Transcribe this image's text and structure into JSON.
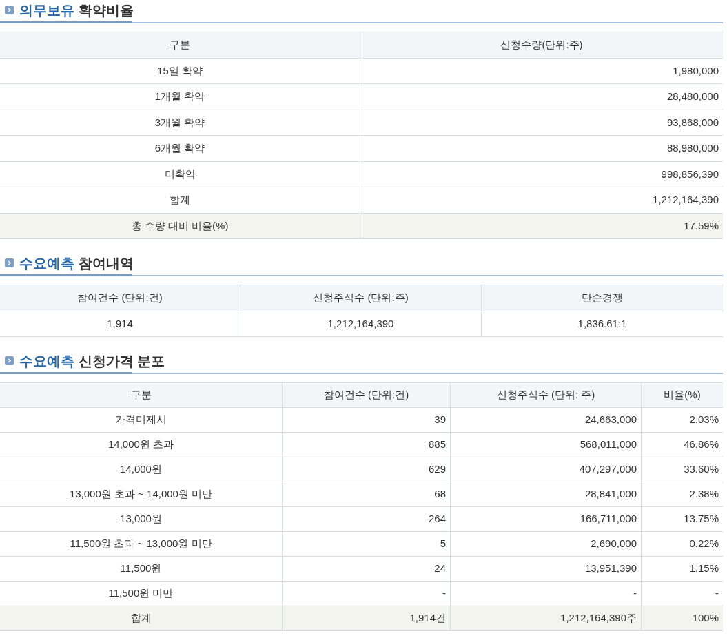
{
  "sections": [
    {
      "title": {
        "highlight": "의무보유",
        "rest": "확약비율"
      },
      "kind": "list",
      "columns": [
        "구분",
        "신청수량(단위:주)"
      ],
      "rows": [
        {
          "kind": "data",
          "cells": [
            "15일 확약",
            "1,980,000"
          ]
        },
        {
          "kind": "data",
          "cells": [
            "1개월 확약",
            "28,480,000"
          ]
        },
        {
          "kind": "data",
          "cells": [
            "3개월 확약",
            "93,868,000"
          ]
        },
        {
          "kind": "data",
          "cells": [
            "6개월 확약",
            "88,980,000"
          ]
        },
        {
          "kind": "data",
          "cells": [
            "미확약",
            "998,856,390"
          ]
        },
        {
          "kind": "data",
          "cells": [
            "합계",
            "1,212,164,390"
          ]
        },
        {
          "kind": "total",
          "cells": [
            "총 수량 대비 비율(%)",
            "17.59%"
          ]
        }
      ]
    },
    {
      "title": {
        "highlight": "수요예측",
        "rest": "참여내역"
      },
      "kind": "summary",
      "columns": [
        "참여건수 (단위:건)",
        "신청주식수 (단위:주)",
        "단순경쟁"
      ],
      "rows": [
        {
          "kind": "data",
          "cells": [
            "1,914",
            "1,212,164,390",
            "1,836.61:1"
          ]
        }
      ]
    },
    {
      "title": {
        "highlight": "수요예측",
        "rest": "신청가격 분포"
      },
      "kind": "list",
      "columns": [
        "구분",
        "참여건수 (단위:건)",
        "신청주식수 (단위: 주)",
        "비율(%)"
      ],
      "rows": [
        {
          "kind": "data",
          "cells": [
            "가격미제시",
            "39",
            "24,663,000",
            "2.03%"
          ]
        },
        {
          "kind": "data",
          "cells": [
            "14,000원 초과",
            "885",
            "568,011,000",
            "46.86%"
          ]
        },
        {
          "kind": "data",
          "cells": [
            "14,000원",
            "629",
            "407,297,000",
            "33.60%"
          ]
        },
        {
          "kind": "data",
          "cells": [
            "13,000원 초과 ~ 14,000원 미만",
            "68",
            "28,841,000",
            "2.38%"
          ]
        },
        {
          "kind": "data",
          "cells": [
            "13,000원",
            "264",
            "166,711,000",
            "13.75%"
          ]
        },
        {
          "kind": "data",
          "cells": [
            "11,500원 초과 ~ 13,000원 미만",
            "5",
            "2,690,000",
            "0.22%"
          ]
        },
        {
          "kind": "data",
          "cells": [
            "11,500원",
            "24",
            "13,951,390",
            "1.15%"
          ]
        },
        {
          "kind": "data",
          "cells": [
            "11,500원 미만",
            "-",
            "-",
            "-"
          ]
        },
        {
          "kind": "total",
          "cells": [
            "합계",
            "1,914건",
            "1,212,164,390주",
            "100%"
          ]
        }
      ]
    }
  ]
}
